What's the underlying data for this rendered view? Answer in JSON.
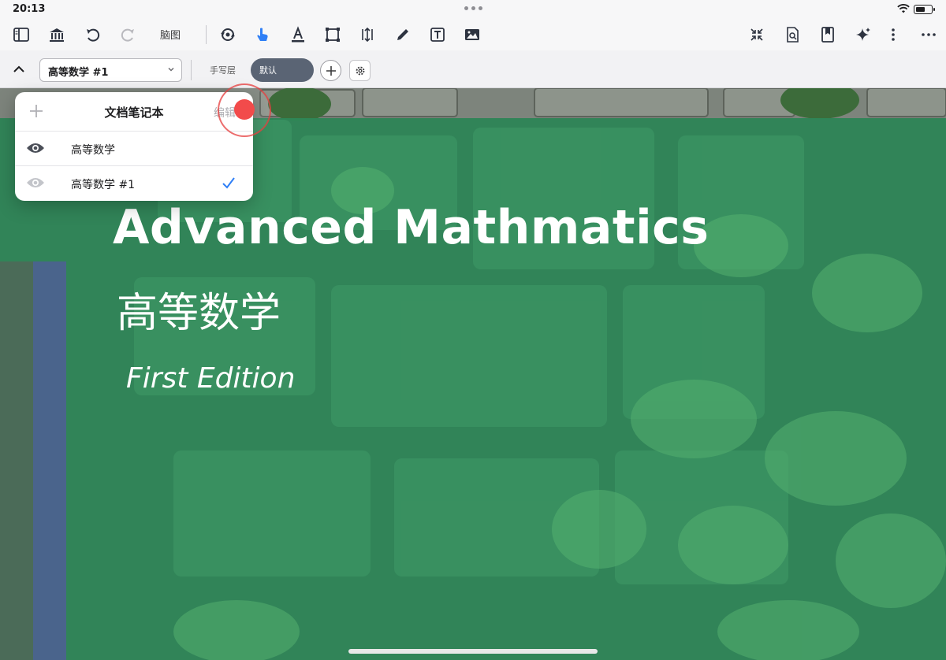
{
  "status_bar": {
    "time": "20:13"
  },
  "toolbar": {
    "mindmap_label": "脑图",
    "icons": [
      "sidebar-icon",
      "library-icon",
      "undo-icon",
      "redo-icon",
      "rotate-view-icon",
      "hand-pointer-icon",
      "text-color-icon",
      "crop-frame-icon",
      "resize-icon",
      "pencil-icon",
      "text-box-icon",
      "image-icon",
      "collapse-arrows-icon",
      "search-document-icon",
      "bookmark-icon",
      "sparkle-icon",
      "more-vertical-icon",
      "more-horizontal-icon"
    ],
    "accent_color": "#2f7ff6"
  },
  "layer_bar": {
    "notebook_select": "高等数学 #1",
    "handwriting_layer": "手写层",
    "default_layer": "默认"
  },
  "popover": {
    "title": "文档笔记本",
    "edit_label": "编辑",
    "items": [
      {
        "label": "高等数学",
        "visible": true,
        "selected": false
      },
      {
        "label": "高等数学 #1",
        "visible": false,
        "selected": true
      }
    ]
  },
  "cover": {
    "title": "Advanced Mathmatics",
    "subtitle": "高等数学",
    "edition": "First Edition",
    "overlay_color": "#2e8a5a"
  }
}
